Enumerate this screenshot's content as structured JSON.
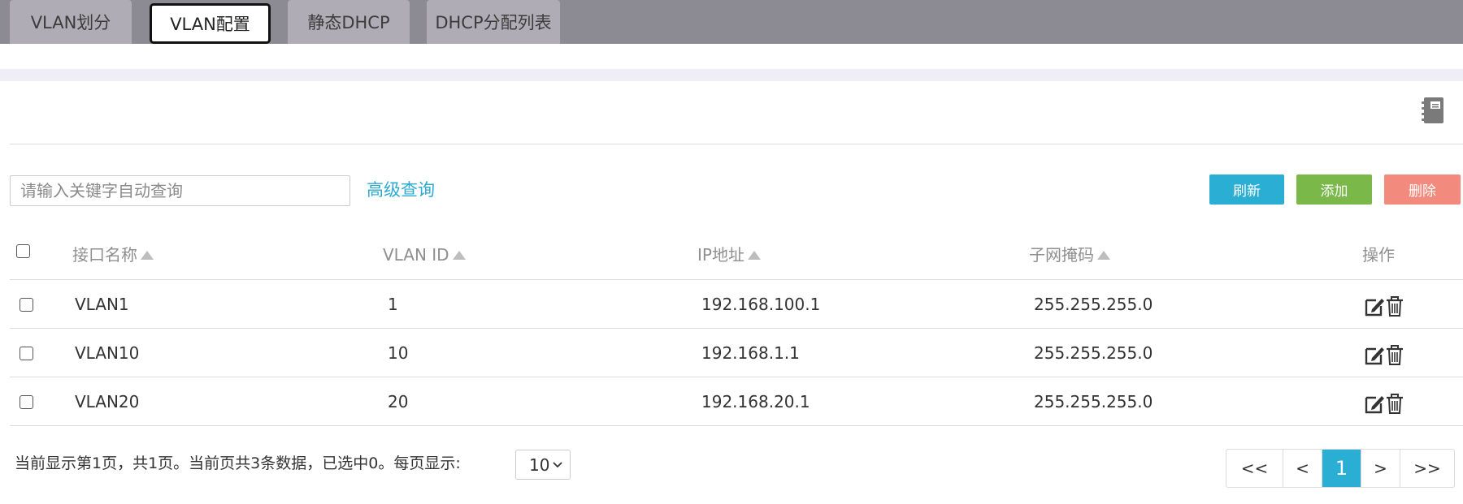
{
  "tabs": [
    {
      "label": "VLAN划分"
    },
    {
      "label": "VLAN配置"
    },
    {
      "label": "静态DHCP"
    },
    {
      "label": "DHCP分配列表"
    }
  ],
  "toolbar": {
    "search_placeholder": "请输入关键字自动查询",
    "advanced_query": "高级查询",
    "refresh": "刷新",
    "add": "添加",
    "delete": "删除"
  },
  "table": {
    "columns": [
      "接口名称",
      "VLAN ID",
      "IP地址",
      "子网掩码",
      "操作"
    ],
    "rows": [
      {
        "name": "VLAN1",
        "vlan_id": "1",
        "ip": "192.168.100.1",
        "mask": "255.255.255.0"
      },
      {
        "name": "VLAN10",
        "vlan_id": "10",
        "ip": "192.168.1.1",
        "mask": "255.255.255.0"
      },
      {
        "name": "VLAN20",
        "vlan_id": "20",
        "ip": "192.168.20.1",
        "mask": "255.255.255.0"
      }
    ]
  },
  "footer": {
    "status_text": "当前显示第1页，共1页。当前页共3条数据，已选中0。每页显示:",
    "page_size": "10"
  },
  "pagination": {
    "first": "<<",
    "prev": "<",
    "current": "1",
    "next": ">",
    "last": ">>"
  },
  "colors": {
    "tabbar": "#8c8a93",
    "accent": "#2aaed3",
    "add": "#7ab84a",
    "delete": "#f28b7d"
  },
  "icons": [
    "notebook-icon",
    "sort-icon",
    "edit-icon",
    "trash-icon",
    "chevron-down-icon"
  ]
}
